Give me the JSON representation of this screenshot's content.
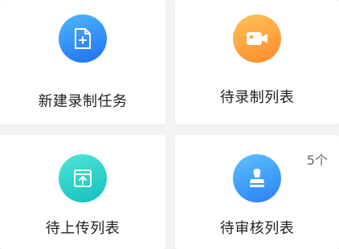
{
  "cards": [
    {
      "label": "新建录制任务",
      "icon": "new-file-icon",
      "color": "#2f8cf5"
    },
    {
      "label": "待录制列表",
      "icon": "video-camera-icon",
      "color": "#ffa23e"
    },
    {
      "label": "待上传列表",
      "icon": "upload-icon",
      "color": "#20cfc8"
    },
    {
      "label": "待审核列表",
      "icon": "review-stamp-icon",
      "color": "#3a8cf5",
      "badge": "5个"
    }
  ]
}
